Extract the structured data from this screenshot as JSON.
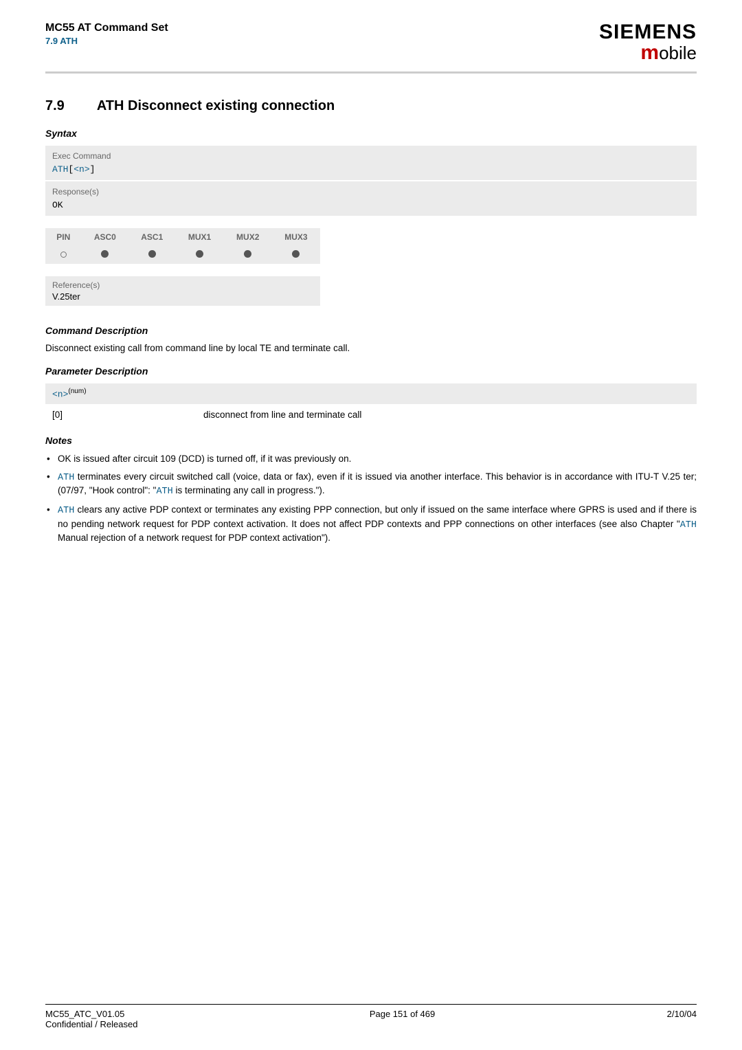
{
  "header": {
    "title": "MC55 AT Command Set",
    "subtitle": "7.9 ATH",
    "brand_top": "SIEMENS",
    "brand_bottom_m": "m",
    "brand_bottom_rest": "obile"
  },
  "section": {
    "number": "7.9",
    "title": "ATH   Disconnect existing connection"
  },
  "syntax": {
    "heading": "Syntax",
    "exec_label": "Exec Command",
    "exec_cmd_prefix": "ATH",
    "exec_cmd_bracket_open": "[",
    "exec_cmd_param": "<n>",
    "exec_cmd_bracket_close": "]",
    "response_label": "Response(s)",
    "response_value": "OK"
  },
  "compat": {
    "headers": [
      "PIN",
      "ASC0",
      "ASC1",
      "MUX1",
      "MUX2",
      "MUX3"
    ],
    "values": [
      "empty",
      "filled",
      "filled",
      "filled",
      "filled",
      "filled"
    ]
  },
  "reference": {
    "label": "Reference(s)",
    "value": "V.25ter"
  },
  "command_description": {
    "heading": "Command Description",
    "text": "Disconnect existing call from command line by local TE and terminate call."
  },
  "parameter_description": {
    "heading": "Parameter Description",
    "param_name": "<n>",
    "param_sup": "(num)",
    "rows": [
      {
        "key": "[0]",
        "desc": "disconnect from line and terminate call"
      }
    ]
  },
  "notes": {
    "heading": "Notes",
    "items": [
      {
        "parts": [
          {
            "t": "OK is issued after circuit 109 (DCD) is turned off, if it was previously on."
          }
        ]
      },
      {
        "parts": [
          {
            "code": "ATH"
          },
          {
            "t": " terminates every circuit switched call (voice, data or fax), even if it is issued via another interface. This behavior is in accordance with ITU-T V.25 ter; (07/97, \"Hook control\": \""
          },
          {
            "code": "ATH"
          },
          {
            "t": " is terminating any call in progress.\")."
          }
        ]
      },
      {
        "parts": [
          {
            "code": "ATH"
          },
          {
            "t": " clears any active PDP context or terminates any existing PPP connection, but only if issued on the same interface where GPRS is used and if there is no pending network request for PDP context activation. It does not affect PDP contexts and PPP connections on other interfaces (see also Chapter \""
          },
          {
            "code": "ATH"
          },
          {
            "t": " Manual rejection of a network request for PDP context activation\")."
          }
        ]
      }
    ]
  },
  "footer": {
    "left_line1": "MC55_ATC_V01.05",
    "left_line2": "Confidential / Released",
    "center": "Page 151 of 469",
    "right": "2/10/04"
  }
}
